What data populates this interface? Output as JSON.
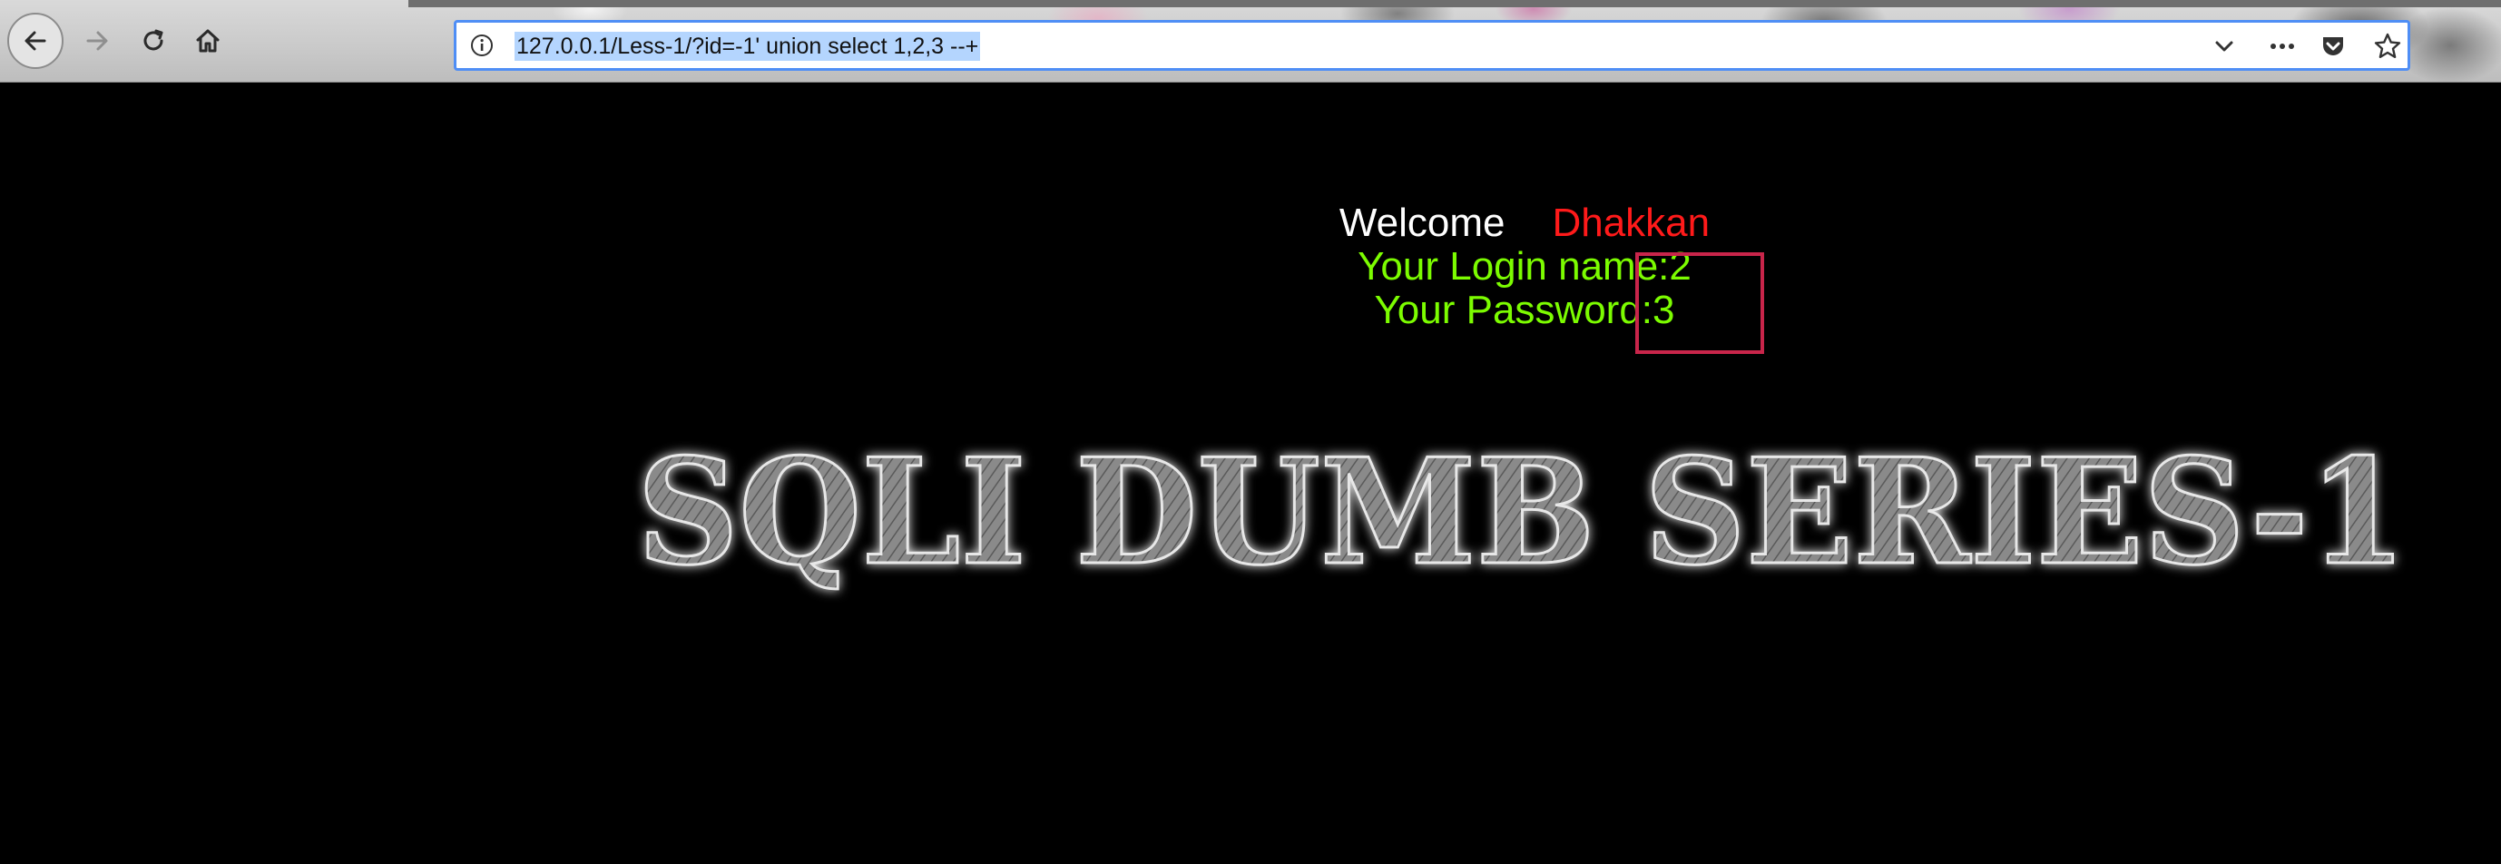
{
  "browser": {
    "url": "127.0.0.1/Less-1/?id=-1' union select 1,2,3 --+",
    "icons": {
      "back": "back-arrow-icon",
      "forward": "forward-arrow-icon",
      "reload": "reload-icon",
      "home": "home-icon",
      "info": "info-icon",
      "dropdown": "chevron-down-icon",
      "more": "more-dots-icon",
      "pocket": "pocket-icon",
      "bookmark": "star-icon"
    },
    "colors": {
      "url_focus_border": "#4f8ef5",
      "url_selection": "#b4d5fe"
    }
  },
  "page": {
    "welcome": {
      "word": "Welcome",
      "name": "Dhakkan"
    },
    "login_line": "Your Login name:2",
    "password_line": "Your Password:3",
    "banner_text": "SQLI DUMB SERIES-1",
    "colors": {
      "background": "#000000",
      "welcome": "#ffffff",
      "name": "#ff1a1a",
      "result_text": "#7cfc00",
      "highlight_box": "#c8254a"
    }
  }
}
